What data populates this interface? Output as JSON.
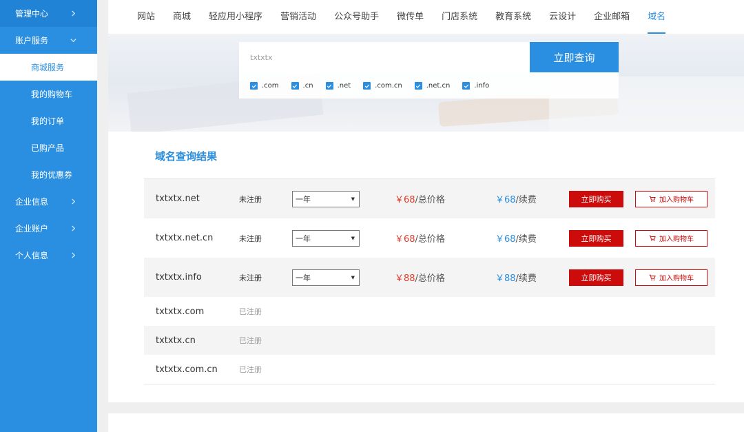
{
  "sidebar": {
    "items": [
      {
        "label": "管理中心",
        "chev": "right"
      },
      {
        "label": "账户服务",
        "chev": "down"
      },
      {
        "label": "商城服务"
      },
      {
        "label": "我的购物车"
      },
      {
        "label": "我的订单"
      },
      {
        "label": "已购产品"
      },
      {
        "label": "我的优惠券"
      },
      {
        "label": "企业信息",
        "chev": "right"
      },
      {
        "label": "企业账户",
        "chev": "right"
      },
      {
        "label": "个人信息",
        "chev": "right"
      }
    ]
  },
  "topnav": {
    "items": [
      "网站",
      "商城",
      "轻应用小程序",
      "营销活动",
      "公众号助手",
      "微传单",
      "门店系统",
      "教育系统",
      "云设计",
      "企业邮箱",
      "域名"
    ],
    "active": "域名"
  },
  "search": {
    "value": "txtxtx",
    "button": "立即查询",
    "tlds": [
      ".com",
      ".cn",
      ".net",
      ".com.cn",
      ".net.cn",
      ".info"
    ]
  },
  "results": {
    "title": "域名查询结果",
    "available": [
      {
        "domain": "txtxtx.net",
        "status": "未注册",
        "period": "一年",
        "price": "￥68",
        "price_unit": "/总价格",
        "renew": "￥68",
        "renew_unit": "/续费",
        "buy": "立即购买",
        "cart": "加入购物车"
      },
      {
        "domain": "txtxtx.net.cn",
        "status": "未注册",
        "period": "一年",
        "price": "￥68",
        "price_unit": "/总价格",
        "renew": "￥68",
        "renew_unit": "/续费",
        "buy": "立即购买",
        "cart": "加入购物车"
      },
      {
        "domain": "txtxtx.info",
        "status": "未注册",
        "period": "一年",
        "price": "￥88",
        "price_unit": "/总价格",
        "renew": "￥88",
        "renew_unit": "/续费",
        "buy": "立即购买",
        "cart": "加入购物车"
      }
    ],
    "registered": [
      {
        "domain": "txtxtx.com",
        "status": "已注册"
      },
      {
        "domain": "txtxtx.cn",
        "status": "已注册"
      },
      {
        "domain": "txtxtx.com.cn",
        "status": "已注册"
      }
    ]
  },
  "colors": {
    "accent": "#2a8fe0",
    "buy": "#cc0b0b",
    "price": "#e03b2a"
  }
}
